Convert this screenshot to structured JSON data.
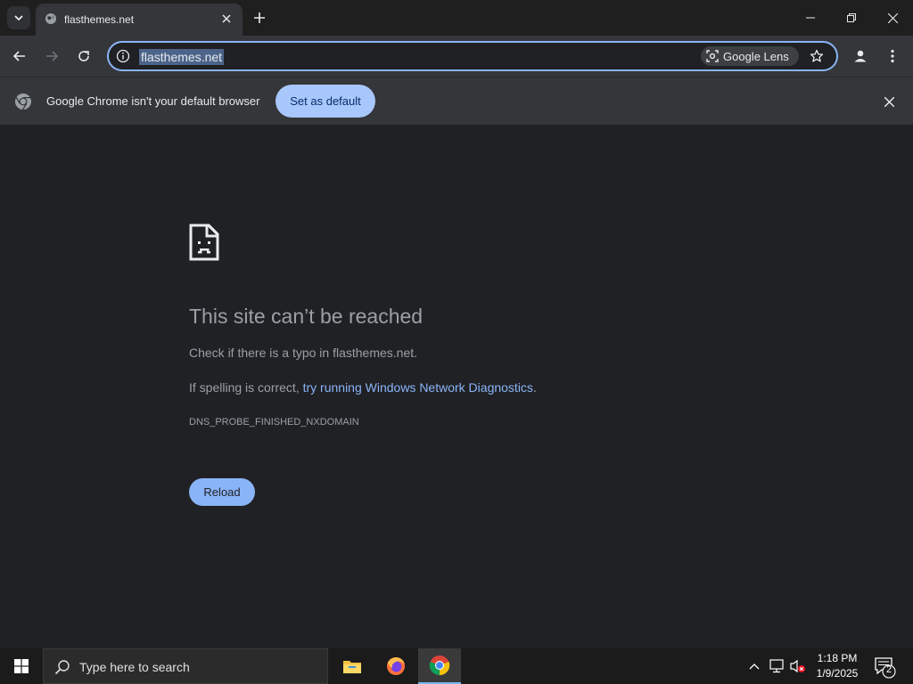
{
  "tab": {
    "title": "flasthemes.net"
  },
  "omnibox": {
    "url": "flasthemes.net",
    "lens_label": "Google Lens"
  },
  "infobar": {
    "message": "Google Chrome isn't your default browser",
    "button_label": "Set as default"
  },
  "error": {
    "title": "This site can’t be reached",
    "line1": "Check if there is a typo in flasthemes.net.",
    "line2_prefix": "If spelling is correct, ",
    "line2_link": "try running Windows Network Diagnostics",
    "line2_suffix": ".",
    "code": "DNS_PROBE_FINISHED_NXDOMAIN",
    "reload_label": "Reload"
  },
  "taskbar": {
    "search_placeholder": "Type here to search",
    "time": "1:18 PM",
    "date": "1/9/2025",
    "notification_count": "2"
  },
  "colors": {
    "accent": "#8ab4f8",
    "background": "#202124",
    "infobar_button": "#a8c7fa"
  }
}
